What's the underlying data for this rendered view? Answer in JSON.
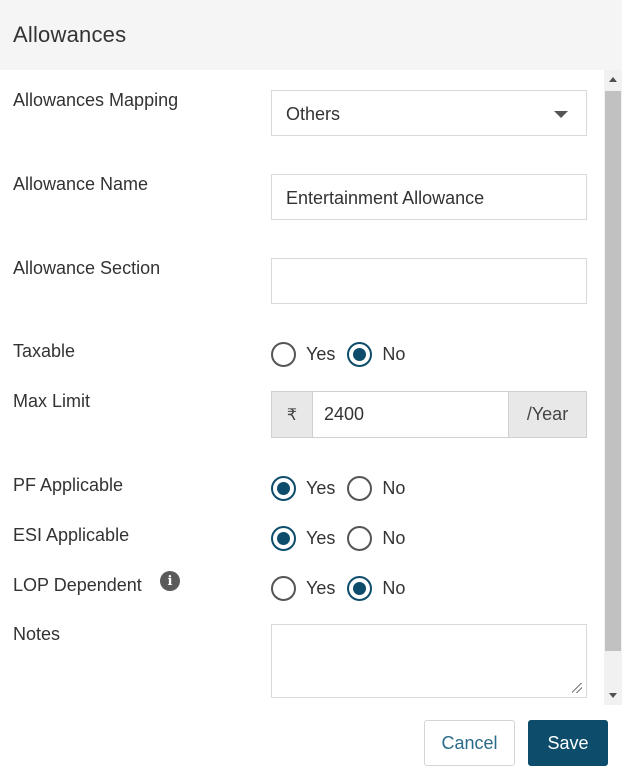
{
  "dialog": {
    "title": "Allowances"
  },
  "form": {
    "mapping": {
      "label": "Allowances Mapping",
      "value": "Others"
    },
    "name": {
      "label": "Allowance Name",
      "value": "Entertainment Allowance"
    },
    "section": {
      "label": "Allowance Section",
      "value": ""
    },
    "taxable": {
      "label": "Taxable",
      "yes": "Yes",
      "no": "No",
      "selected": "No"
    },
    "max_limit": {
      "label": "Max Limit",
      "prefix": "₹",
      "value": "2400",
      "suffix": "/Year"
    },
    "pf": {
      "label": "PF Applicable",
      "yes": "Yes",
      "no": "No",
      "selected": "Yes"
    },
    "esi": {
      "label": "ESI Applicable",
      "yes": "Yes",
      "no": "No",
      "selected": "Yes"
    },
    "lop": {
      "label": "LOP Dependent",
      "yes": "Yes",
      "no": "No",
      "selected": "No",
      "info_icon": "info-icon"
    },
    "notes": {
      "label": "Notes",
      "value": ""
    }
  },
  "footer": {
    "cancel_label": "Cancel",
    "save_label": "Save"
  },
  "colors": {
    "accent": "#0d4d6b",
    "header_bg": "#f5f5f5"
  }
}
